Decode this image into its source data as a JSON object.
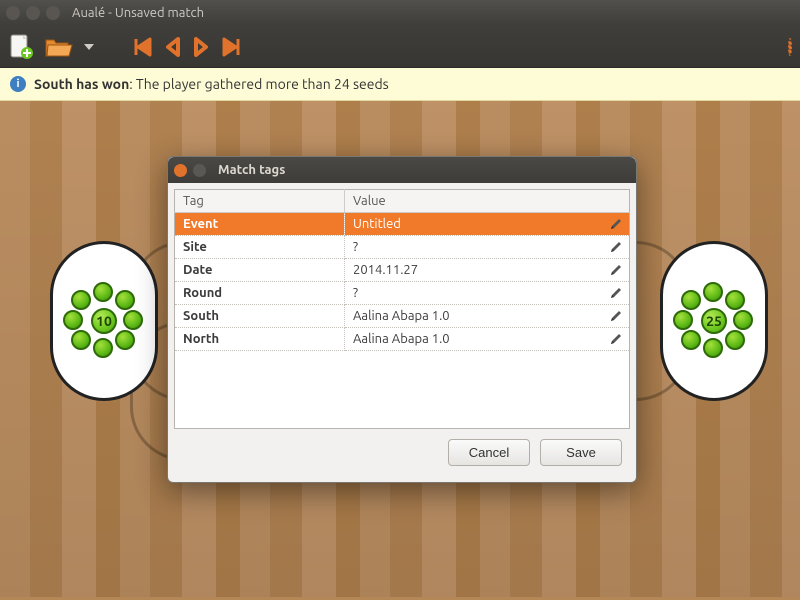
{
  "window": {
    "title": "Aualé - Unsaved match"
  },
  "status": {
    "headline": "South has won",
    "detail": ": The player gathered more than 24 seeds"
  },
  "pits": {
    "left_count": "10",
    "right_count": "25"
  },
  "dialog": {
    "title": "Match tags",
    "columns": {
      "tag": "Tag",
      "value": "Value"
    },
    "rows": [
      {
        "tag": "Event",
        "value": "Untitled",
        "selected": true
      },
      {
        "tag": "Site",
        "value": "?"
      },
      {
        "tag": "Date",
        "value": "2014.11.27"
      },
      {
        "tag": "Round",
        "value": "?"
      },
      {
        "tag": "South",
        "value": "Aalina Abapa 1.0"
      },
      {
        "tag": "North",
        "value": "Aalina Abapa 1.0"
      }
    ],
    "buttons": {
      "cancel": "Cancel",
      "save": "Save"
    }
  },
  "colors": {
    "accent": "#f07a2a",
    "seed": "#5cb815",
    "status_bg": "#fefcd6"
  }
}
